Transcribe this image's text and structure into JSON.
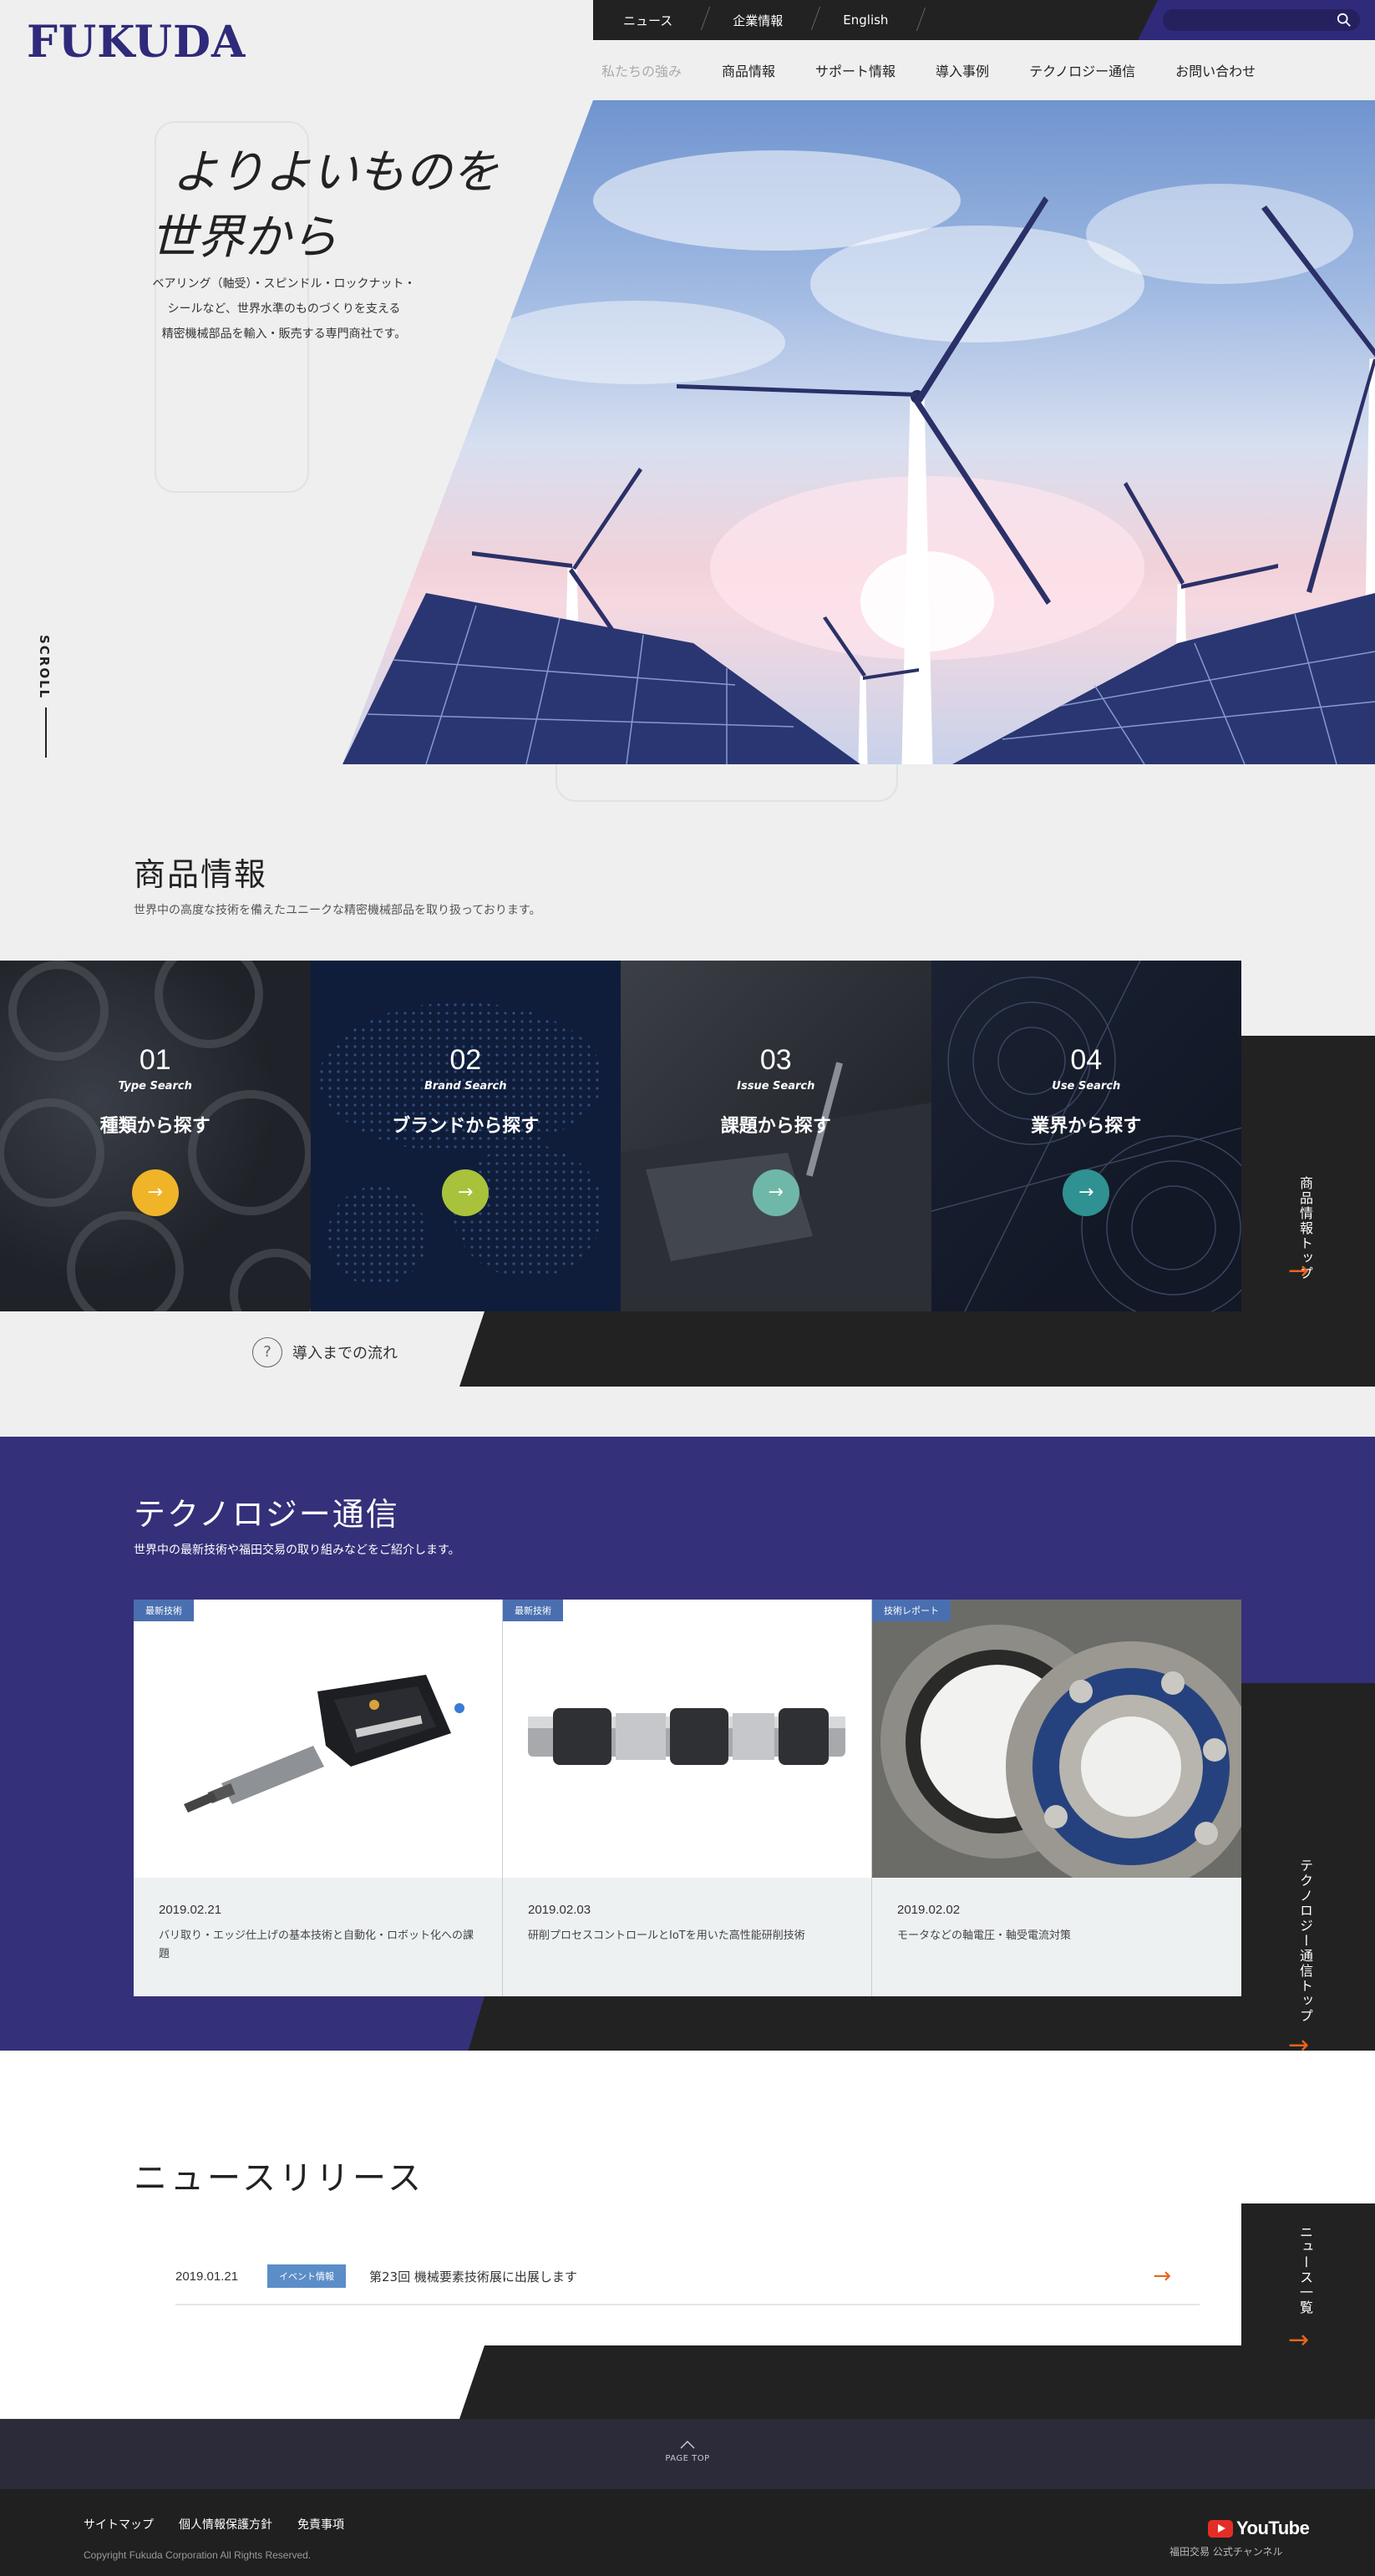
{
  "header": {
    "logo": "FUKUDA",
    "top_links": [
      "ニュース",
      "企業情報",
      "English"
    ],
    "search_placeholder": "",
    "nav": [
      "私たちの強み",
      "商品情報",
      "サポート情報",
      "導入事例",
      "テクノロジー通信",
      "お問い合わせ"
    ]
  },
  "hero": {
    "title_line1": "よりよいものを",
    "title_line2": "世界から",
    "desc_line1": "ベアリング（軸受）・スピンドル・ロックナット・",
    "desc_line2": "シールなど、世界水準のものづくりを支える",
    "desc_line3": "精密機械部品を輸入・販売する専門商社です。",
    "scroll_label": "SCROLL"
  },
  "products": {
    "title": "商品情報",
    "subtitle": "世界中の高度な技術を備えたユニークな精密機械部品を取り扱っております。",
    "cards": [
      {
        "num": "01",
        "en": "Type Search",
        "jp": "種類から探す",
        "color": "#f0b428"
      },
      {
        "num": "02",
        "en": "Brand Search",
        "jp": "ブランドから探す",
        "color": "#a8c23c"
      },
      {
        "num": "03",
        "en": "Issue Search",
        "jp": "課題から探す",
        "color": "#6fb8a8"
      },
      {
        "num": "04",
        "en": "Use Search",
        "jp": "業界から探す",
        "color": "#2f9191"
      }
    ],
    "side_label": "商品情報トップ",
    "arrow": "→",
    "flow_link": "導入までの流れ",
    "flow_icon": "?"
  },
  "technology": {
    "title": "テクノロジー通信",
    "subtitle": "世界中の最新技術や福田交易の取り組みなどをご紹介します。",
    "cards": [
      {
        "tag": "最新技術",
        "date": "2019.02.21",
        "title": "バリ取り・エッジ仕上げの基本技術と自動化・ロボット化への課題"
      },
      {
        "tag": "最新技術",
        "date": "2019.02.03",
        "title": "研削プロセスコントロールとIoTを用いた高性能研削技術"
      },
      {
        "tag": "技術レポート",
        "date": "2019.02.02",
        "title": "モータなどの軸電圧・軸受電流対策"
      }
    ],
    "side_label": "テクノロジー通信トップ"
  },
  "news": {
    "title": "ニュースリリース",
    "items": [
      {
        "date": "2019.01.21",
        "tag": "イベント情報",
        "title": "第23回 機械要素技術展に出展します"
      }
    ],
    "side_label": "ニュース一覧"
  },
  "footer": {
    "page_top": "PAGE TOP",
    "links": [
      "サイトマップ",
      "個人情報保護方針",
      "免責事項"
    ],
    "copyright": "Copyright Fukuda Corporation All Rights Reserved.",
    "youtube": "YouTube",
    "youtube_caption": "福田交易 公式チャンネル"
  },
  "colors": {
    "brand": "#2f2a7a",
    "tech_bg": "#35307a",
    "accent_arrow": "#e8641e",
    "tag_blue": "#4a6fb0"
  }
}
